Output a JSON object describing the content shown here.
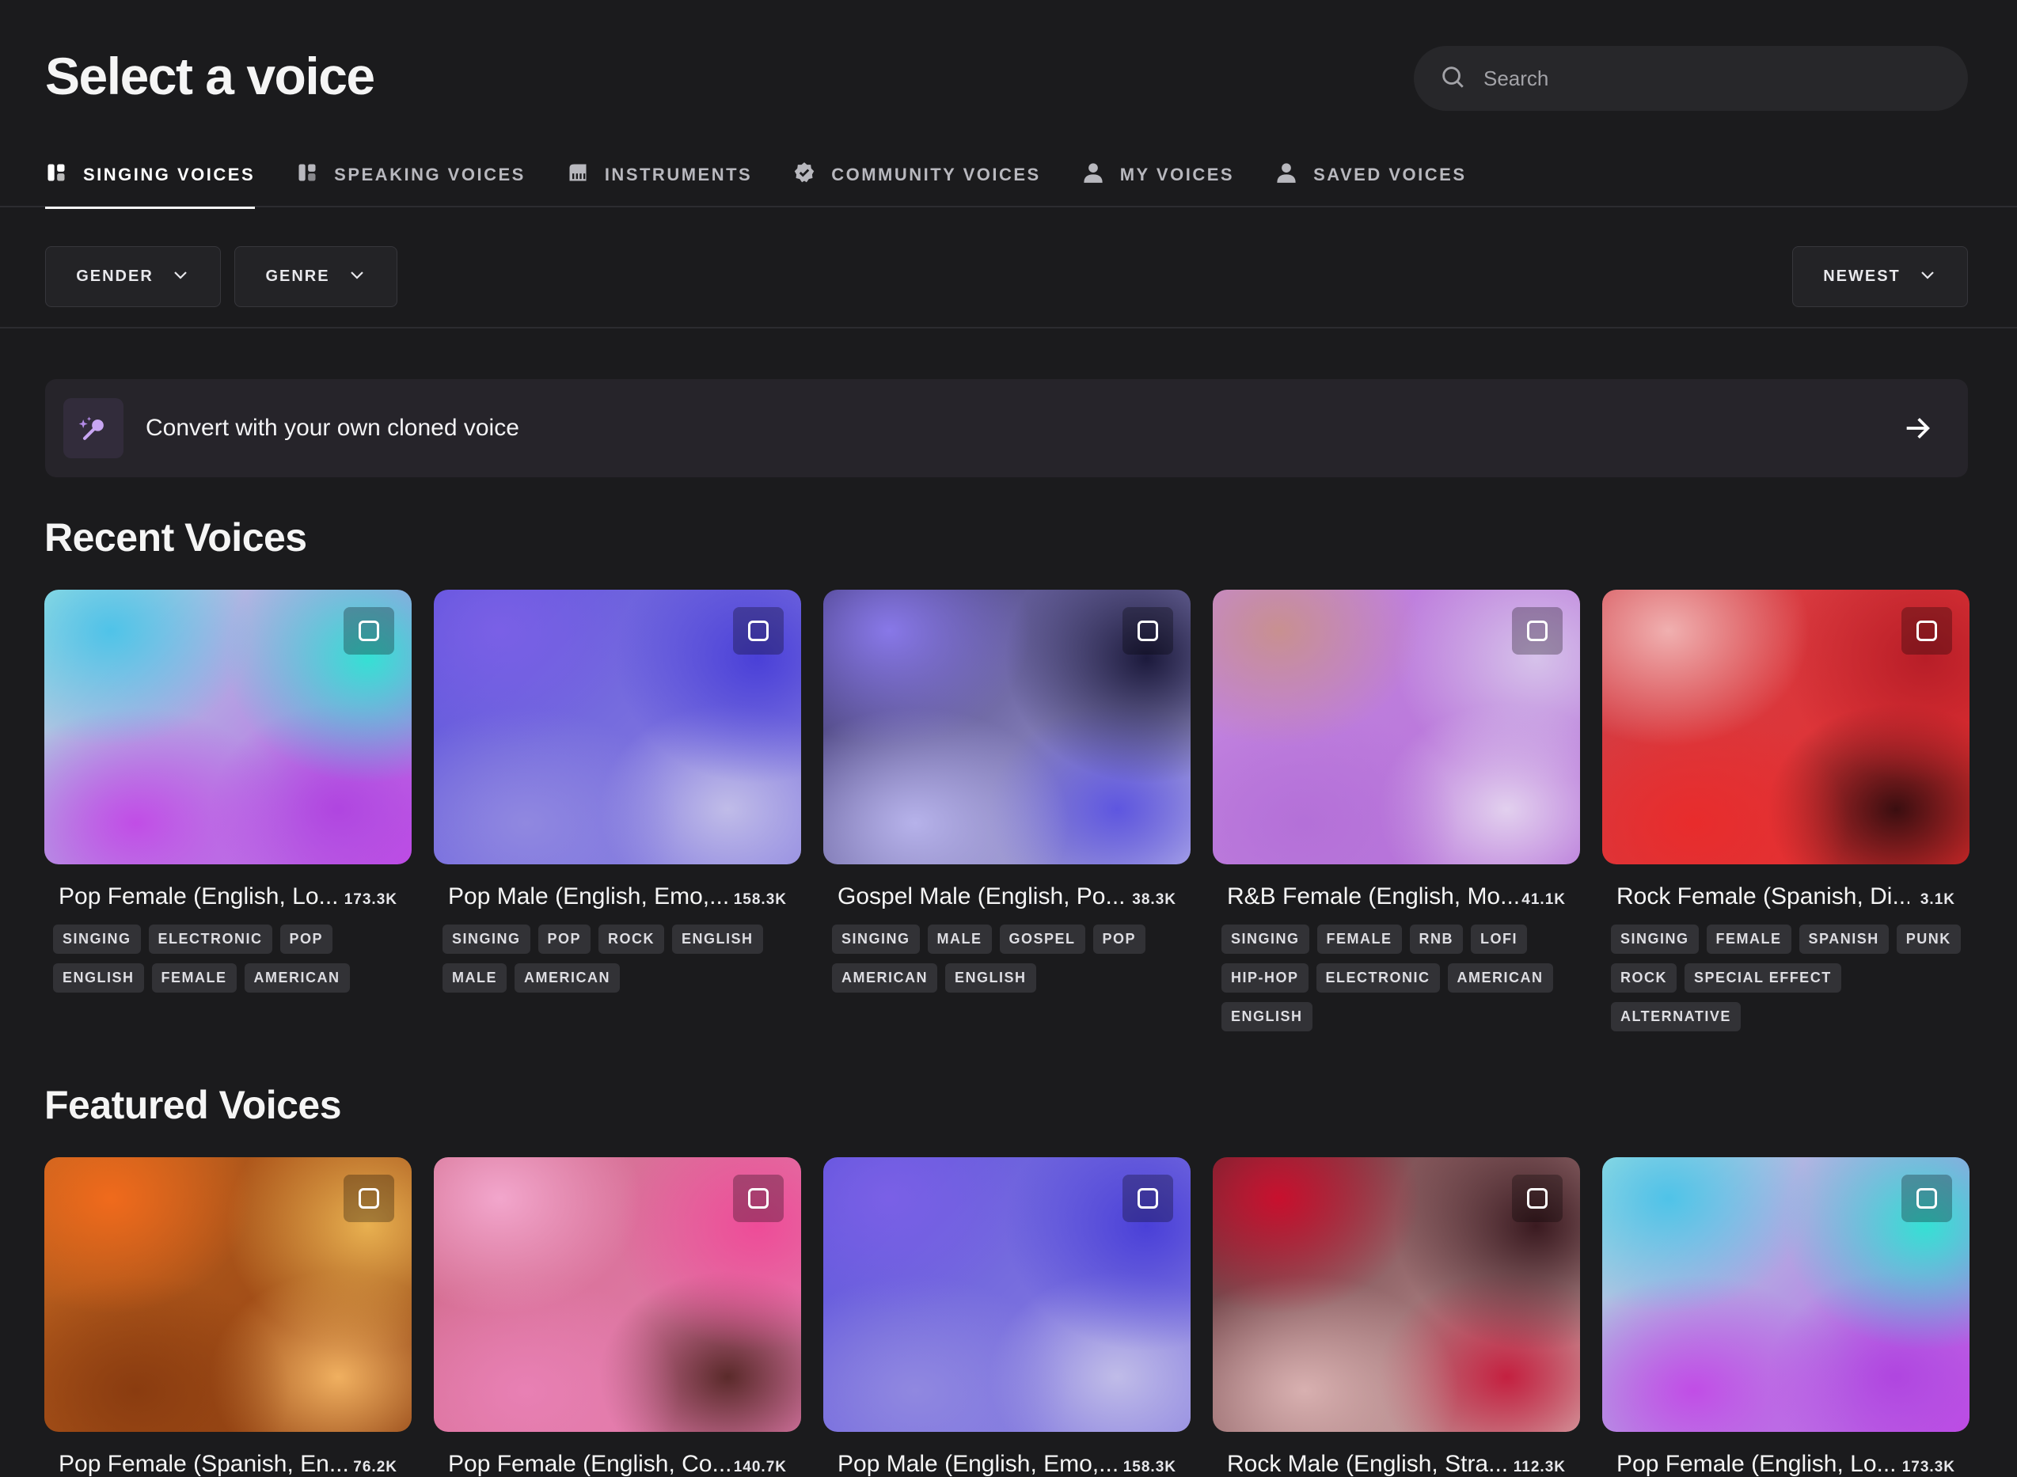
{
  "page": {
    "title": "Select a voice"
  },
  "search": {
    "placeholder": "Search",
    "icon": "search-icon"
  },
  "tabs": [
    {
      "label": "SINGING VOICES",
      "icon": "singing-voice-icon",
      "active": true
    },
    {
      "label": "SPEAKING VOICES",
      "icon": "speaking-voice-icon",
      "active": false
    },
    {
      "label": "INSTRUMENTS",
      "icon": "piano-icon",
      "active": false
    },
    {
      "label": "COMMUNITY VOICES",
      "icon": "verified-badge-icon",
      "active": false
    },
    {
      "label": "MY VOICES",
      "icon": "person-icon",
      "active": false
    },
    {
      "label": "SAVED VOICES",
      "icon": "person-icon",
      "active": false
    }
  ],
  "filters": {
    "gender": "GENDER",
    "genre": "GENRE",
    "sort": "NEWEST"
  },
  "clone_banner": {
    "label": "Convert with your own cloned voice",
    "icon": "sparkle-microphone-icon",
    "arrow": "arrow-right-icon"
  },
  "recent": {
    "title": "Recent Voices",
    "cards": [
      {
        "title": "Pop Female (English, Lo...",
        "count": "173.3K",
        "tags": [
          "SINGING",
          "ELECTRONIC",
          "POP",
          "ENGLISH",
          "FEMALE",
          "AMERICAN"
        ],
        "colors": [
          "#4fc3e8",
          "#35e0d4",
          "#c14de6",
          "#b045e0",
          "#a8e6e0"
        ]
      },
      {
        "title": "Pop Male (English, Emo,...",
        "count": "158.3K",
        "tags": [
          "SINGING",
          "POP",
          "ROCK",
          "ENGLISH",
          "MALE",
          "AMERICAN"
        ],
        "colors": [
          "#7a60e6",
          "#4a40d8",
          "#9088e0",
          "#c0bce8",
          "#5e52dc"
        ]
      },
      {
        "title": "Gospel Male (English, Po...",
        "count": "38.3K",
        "tags": [
          "SINGING",
          "MALE",
          "GOSPEL",
          "POP",
          "AMERICAN",
          "ENGLISH"
        ],
        "colors": [
          "#8878e8",
          "#1c1a3c",
          "#b6b2ea",
          "#5e56e0",
          "#3a3270"
        ]
      },
      {
        "title": "R&B Female (English, Mo...",
        "count": "41.1K",
        "tags": [
          "SINGING",
          "FEMALE",
          "RNB",
          "LOFI",
          "HIP-HOP",
          "ELECTRONIC",
          "AMERICAN",
          "ENGLISH"
        ],
        "colors": [
          "#c89090",
          "#d6c2ea",
          "#b470d8",
          "#e2d0ee",
          "#c486e0"
        ]
      },
      {
        "title": "Rock Female (Spanish, Di...",
        "count": "3.1K",
        "tags": [
          "SINGING",
          "FEMALE",
          "SPANISH",
          "PUNK",
          "ROCK",
          "SPECIAL EFFECT",
          "ALTERNATIVE"
        ],
        "colors": [
          "#f0b0b0",
          "#b81e28",
          "#e82c2c",
          "#3a0e10",
          "#d04048"
        ]
      }
    ]
  },
  "featured": {
    "title": "Featured Voices",
    "cards": [
      {
        "title": "Pop Female (Spanish, En...",
        "count": "76.2K",
        "tags": [],
        "colors": [
          "#f06a1c",
          "#e8b050",
          "#8a3c10",
          "#f0b060",
          "#c06420"
        ]
      },
      {
        "title": "Pop Female (English, Co...",
        "count": "140.7K",
        "tags": [],
        "colors": [
          "#f2a6cc",
          "#ee4c98",
          "#e880b4",
          "#5a2a2a",
          "#d06a8a"
        ]
      },
      {
        "title": "Pop Male (English, Emo,...",
        "count": "158.3K",
        "tags": [],
        "colors": [
          "#7a60e6",
          "#4a40d8",
          "#9088e0",
          "#c0bce8",
          "#5e52dc"
        ]
      },
      {
        "title": "Rock Male (English, Stra...",
        "count": "112.3K",
        "tags": [],
        "colors": [
          "#c8102e",
          "#3a1a20",
          "#d8b0b0",
          "#c42040",
          "#5a2a30"
        ]
      },
      {
        "title": "Pop Female (English, Lo...",
        "count": "173.3K",
        "tags": [],
        "colors": [
          "#4fc3e8",
          "#35e0d4",
          "#c14de6",
          "#b045e0",
          "#a8e6e0"
        ]
      }
    ]
  }
}
